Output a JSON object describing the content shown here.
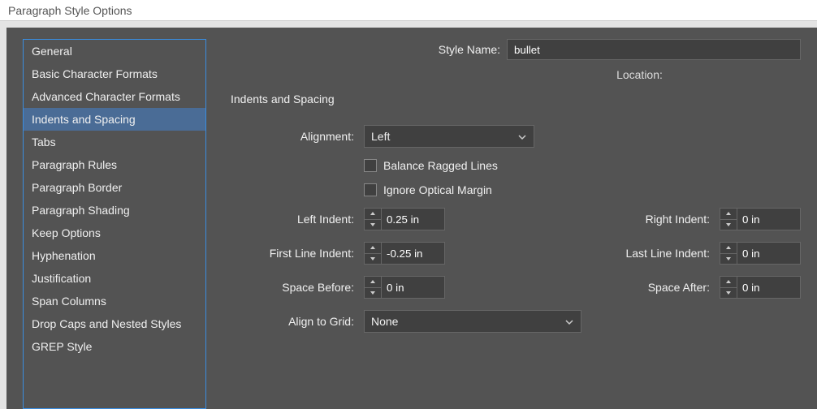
{
  "window": {
    "title": "Paragraph Style Options"
  },
  "sidebar": {
    "items": [
      {
        "label": "General"
      },
      {
        "label": "Basic Character Formats"
      },
      {
        "label": "Advanced Character Formats"
      },
      {
        "label": "Indents and Spacing",
        "selected": true
      },
      {
        "label": "Tabs"
      },
      {
        "label": "Paragraph Rules"
      },
      {
        "label": "Paragraph Border"
      },
      {
        "label": "Paragraph Shading"
      },
      {
        "label": "Keep Options"
      },
      {
        "label": "Hyphenation"
      },
      {
        "label": "Justification"
      },
      {
        "label": "Span Columns"
      },
      {
        "label": "Drop Caps and Nested Styles"
      },
      {
        "label": "GREP Style"
      }
    ]
  },
  "header": {
    "style_name_label": "Style Name:",
    "style_name_value": "bullet",
    "location_label": "Location:",
    "section_title": "Indents and Spacing"
  },
  "form": {
    "alignment_label": "Alignment:",
    "alignment_value": "Left",
    "balance_label": "Balance Ragged Lines",
    "ignore_label": "Ignore Optical Margin",
    "left_indent_label": "Left Indent:",
    "left_indent_value": "0.25 in",
    "right_indent_label": "Right Indent:",
    "right_indent_value": "0 in",
    "first_line_label": "First Line Indent:",
    "first_line_value": "-0.25 in",
    "last_line_label": "Last Line Indent:",
    "last_line_value": "0 in",
    "space_before_label": "Space Before:",
    "space_before_value": "0 in",
    "space_after_label": "Space After:",
    "space_after_value": "0 in",
    "align_grid_label": "Align to Grid:",
    "align_grid_value": "None"
  }
}
